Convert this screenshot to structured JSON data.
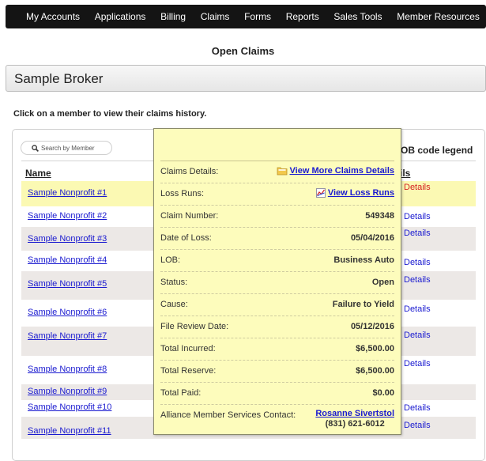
{
  "nav": {
    "items": [
      "My Accounts",
      "Applications",
      "Billing",
      "Claims",
      "Forms",
      "Reports",
      "Sales Tools",
      "Member Resources"
    ]
  },
  "page": {
    "title": "Open Claims",
    "broker_name": "Sample Broker",
    "instruction": "Click on a member to view their claims history."
  },
  "list": {
    "search_placeholder": "Search by Member",
    "legend_label": "OB code legend",
    "col_name": "Name",
    "col_details": "ils",
    "members": [
      {
        "name": "Sample Nonprofit #1",
        "details": "Details"
      },
      {
        "name": "Sample Nonprofit #2",
        "details": "Details"
      },
      {
        "name": "Sample Nonprofit #3",
        "details": "Details"
      },
      {
        "name": "Sample Nonprofit #4",
        "details": "Details"
      },
      {
        "name": "Sample Nonprofit #5",
        "details": "Details"
      },
      {
        "name": "Sample Nonprofit #6",
        "details": "Details"
      },
      {
        "name": "Sample Nonprofit #7",
        "details": "Details"
      },
      {
        "name": "Sample Nonprofit #8",
        "details": "Details"
      },
      {
        "name": "Sample Nonprofit #9",
        "details": ""
      },
      {
        "name": "Sample Nonprofit #10",
        "details": "Details"
      },
      {
        "name": "Sample Nonprofit #11",
        "details": "Details"
      }
    ]
  },
  "popup": {
    "claims_details_label": "Claims Details:",
    "claims_details_link": "View More Claims Details",
    "loss_runs_label": "Loss Runs:",
    "loss_runs_link": "View Loss Runs",
    "claim_number_label": "Claim Number:",
    "claim_number": "549348",
    "date_of_loss_label": "Date of Loss:",
    "date_of_loss": "05/04/2016",
    "lob_label": "LOB:",
    "lob": "Business Auto",
    "status_label": "Status:",
    "status": "Open",
    "cause_label": "Cause:",
    "cause": "Failure to Yield",
    "file_review_label": "File Review Date:",
    "file_review": "05/12/2016",
    "total_incurred_label": "Total Incurred:",
    "total_incurred": "$6,500.00",
    "total_reserve_label": "Total Reserve:",
    "total_reserve": "$6,500.00",
    "total_paid_label": "Total Paid:",
    "total_paid": "$0.00",
    "contact_label": "Alliance Member Services Contact:",
    "contact_name": "Rosanne Sivertstol",
    "contact_phone": "(831) 621-6012"
  },
  "colors": {
    "nav_bg": "#141414",
    "link": "#1a1ad0",
    "highlight_row": "#fbf9b3",
    "popup_bg": "#fdfcbc",
    "details_active": "#d42020"
  }
}
